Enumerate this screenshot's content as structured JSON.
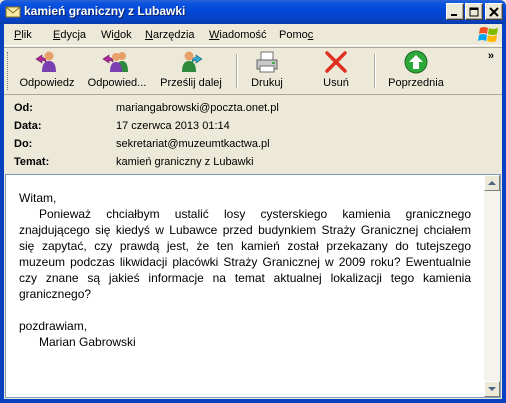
{
  "window": {
    "title": "kamień graniczny z Lubawki"
  },
  "menu": {
    "items": [
      {
        "prefix": "",
        "accel": "P",
        "rest": "lik"
      },
      {
        "prefix": "",
        "accel": "E",
        "rest": "dycja"
      },
      {
        "prefix": "Wi",
        "accel": "d",
        "rest": "ok"
      },
      {
        "prefix": "",
        "accel": "N",
        "rest": "arzędzia"
      },
      {
        "prefix": "",
        "accel": "W",
        "rest": "iadomość"
      },
      {
        "prefix": "Pomo",
        "accel": "c",
        "rest": ""
      }
    ]
  },
  "toolbar": {
    "reply": "Odpowiedz",
    "reply_all": "Odpowied...",
    "forward": "Prześlij dalej",
    "print": "Drukuj",
    "delete": "Usuń",
    "previous": "Poprzednia",
    "more": "»"
  },
  "header": {
    "from_label": "Od:",
    "from_value": "mariangabrowski@poczta.onet.pl",
    "date_label": "Data:",
    "date_value": "17 czerwca 2013 01:14",
    "to_label": "Do:",
    "to_value": "sekretariat@muzeumtkactwa.pl",
    "subject_label": "Temat:",
    "subject_value": "kamień graniczny z Lubawki"
  },
  "message": {
    "greeting": "Witam,",
    "paragraph": "Ponieważ chciałbym ustalić losy cysterskiego kamienia granicznego znajdującego się kiedyś w Lubawce przed budynkiem Straży Granicznej chciałem się zapytać, czy prawdą jest, że ten kamień został przekazany do tutejszego muzeum podczas likwidacji placówki Straży Granicznej w 2009 roku? Ewentualnie czy znane są jakieś informacje na temat aktualnej lokalizacji tego kamienia granicznego?",
    "closing": "pozdrawiam,",
    "signature": "Marian Gabrowski"
  },
  "colors": {
    "titlebar": "#0046d5",
    "face": "#ece9d8",
    "delete_red": "#e03020",
    "previous_green": "#2fa83a"
  },
  "icons": {
    "window": "mail-envelope-icon",
    "reply": "reply-person-icon",
    "reply_all": "reply-all-people-icon",
    "forward": "forward-person-icon",
    "print": "printer-icon",
    "delete": "red-x-icon",
    "previous": "green-up-arrow-icon"
  }
}
